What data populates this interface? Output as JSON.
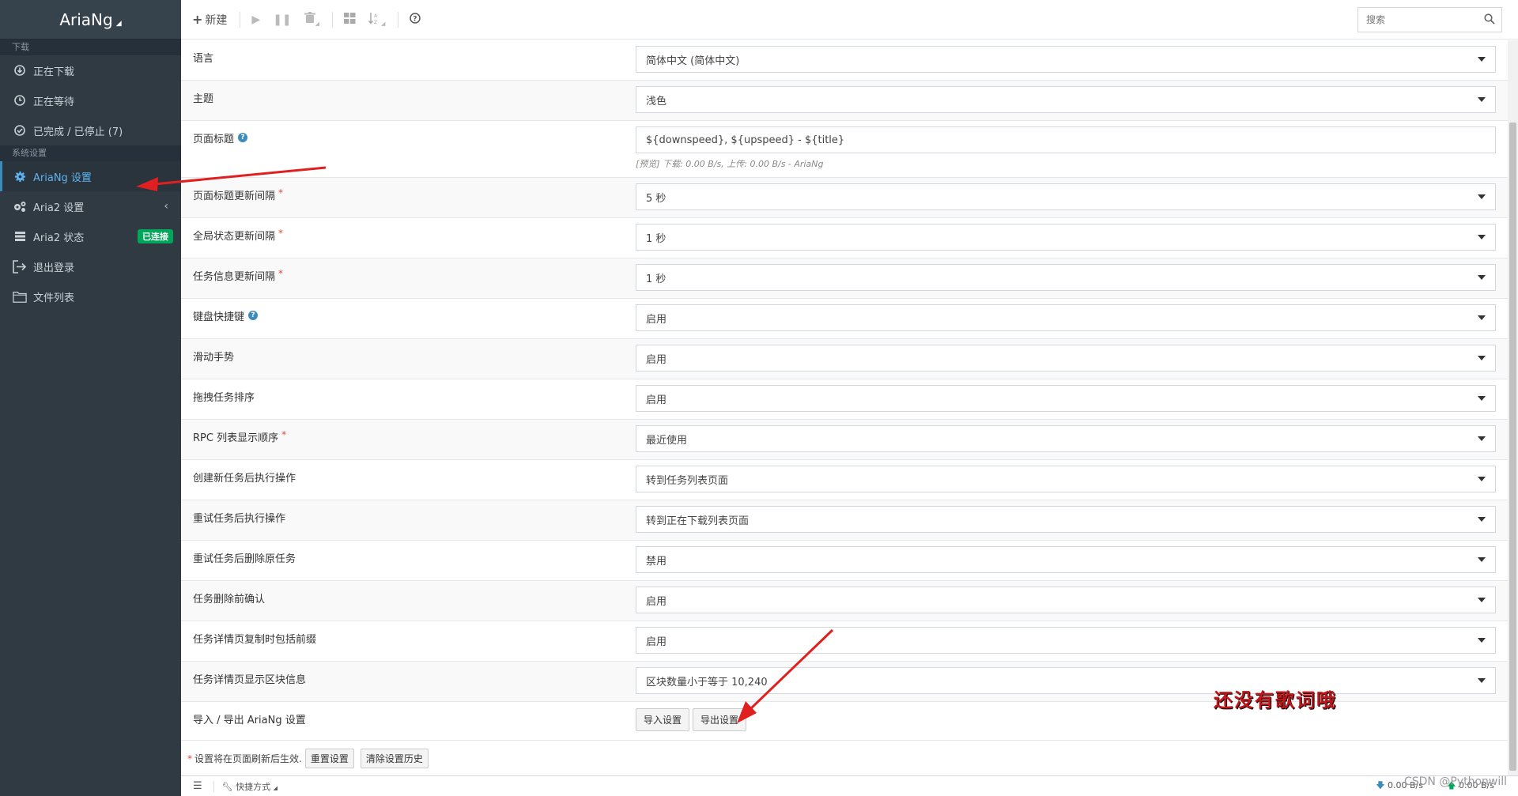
{
  "app": {
    "title": "AriaNg"
  },
  "sidebar": {
    "download_header": "下载",
    "download_items": [
      {
        "label": "正在下载",
        "icon": "download-circle-icon"
      },
      {
        "label": "正在等待",
        "icon": "clock-icon"
      },
      {
        "label": "已完成 / 已停止 (7)",
        "icon": "check-circle-icon"
      }
    ],
    "settings_header": "系统设置",
    "settings_items": [
      {
        "label": "AriaNg 设置",
        "icon": "gear-icon",
        "active": true
      },
      {
        "label": "Aria2 设置",
        "icon": "gears-icon"
      },
      {
        "label": "Aria2 状态",
        "icon": "server-icon",
        "badge": "已连接"
      },
      {
        "label": "退出登录",
        "icon": "logout-icon"
      },
      {
        "label": "文件列表",
        "icon": "folder-icon"
      }
    ]
  },
  "toolbar": {
    "new_label": "新建",
    "search_placeholder": "搜索"
  },
  "settings": [
    {
      "label": "语言",
      "type": "select",
      "value": "简体中文 (简体中文)"
    },
    {
      "label": "主题",
      "type": "select",
      "value": "浅色"
    },
    {
      "label": "页面标题",
      "type": "text",
      "value": "${downspeed}, ${upspeed} - ${title}",
      "hint": "[预览] 下载: 0.00 B/s, 上传: 0.00 B/s - AriaNg",
      "help": "?"
    },
    {
      "label": "页面标题更新间隔",
      "type": "select",
      "value": "5 秒",
      "required": "*"
    },
    {
      "label": "全局状态更新间隔",
      "type": "select",
      "value": "1 秒",
      "required": "*"
    },
    {
      "label": "任务信息更新间隔",
      "type": "select",
      "value": "1 秒",
      "required": "*"
    },
    {
      "label": "键盘快捷键",
      "type": "select",
      "value": "启用",
      "help": "?"
    },
    {
      "label": "滑动手势",
      "type": "select",
      "value": "启用"
    },
    {
      "label": "拖拽任务排序",
      "type": "select",
      "value": "启用"
    },
    {
      "label": "RPC 列表显示顺序",
      "type": "select",
      "value": "最近使用",
      "required": "*"
    },
    {
      "label": "创建新任务后执行操作",
      "type": "select",
      "value": "转到任务列表页面"
    },
    {
      "label": "重试任务后执行操作",
      "type": "select",
      "value": "转到正在下载列表页面"
    },
    {
      "label": "重试任务后删除原任务",
      "type": "select",
      "value": "禁用"
    },
    {
      "label": "任务删除前确认",
      "type": "select",
      "value": "启用"
    },
    {
      "label": "任务详情页复制时包括前缀",
      "type": "select",
      "value": "启用"
    },
    {
      "label": "任务详情页显示区块信息",
      "type": "select",
      "value": "区块数量小于等于 10,240"
    }
  ],
  "import_export": {
    "label": "导入 / 导出 AriaNg 设置",
    "import_label": "导入设置",
    "export_label": "导出设置"
  },
  "footer": {
    "note": "设置将在页面刷新后生效.",
    "note_star": "*",
    "reset_label": "重置设置",
    "clear_history_label": "清除设置历史"
  },
  "bottombar": {
    "shortcut_label": "快捷方式",
    "download_speed": "0.00 B/s",
    "upload_speed": "0.00 B/s"
  },
  "annotation": {
    "text": "还没有歌词哦"
  },
  "watermark": {
    "text": "CSDN @Pythonwill"
  },
  "colors": {
    "sidebar_bg": "#2f3a42",
    "accent": "#3c8dbc",
    "badge_green": "#00a65a",
    "arrow_red": "#e02020"
  }
}
